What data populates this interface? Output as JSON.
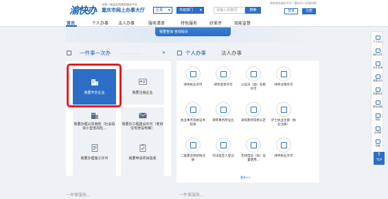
{
  "header": {
    "logo": "渝快办",
    "logo_sub": "全国一体化在线政务服务平台",
    "portal_title": "重庆市网上办事大厅",
    "region_select": "区县",
    "dept_select": "市级部门",
    "search_placeholder": "请输入关键词",
    "search_button": "搜索",
    "top_links": "渝快政务服务平台 | 重庆市人民政府网",
    "login": "登录",
    "register": "注册"
  },
  "nav": {
    "items": [
      "首页",
      "个人办事",
      "法人办事",
      "服务清单",
      "特色服务",
      "好差评",
      "效能监督"
    ]
  },
  "banner": {
    "text": "我要查询 咨询投诉"
  },
  "sections": {
    "one_thing": "一件事一次办",
    "one_thing_more": "»",
    "tab_personal": "个人办事",
    "tab_legal": "法人办事",
    "more": "更多>>"
  },
  "one_thing_tiles": [
    {
      "label": "我要开办企业"
    },
    {
      "label": "我要注销企业"
    },
    {
      "label": "我要办理公共用地（社会投资小型低风险..."
    },
    {
      "label": "我要办工程建设许可（老旧住宅增设电梯）"
    },
    {
      "label": "我要办理施工许可"
    },
    {
      "label": "我要申请项目验收"
    }
  ],
  "personal_services": [
    {
      "label": "律师执业许可"
    },
    {
      "label": "律师变更许可"
    },
    {
      "label": "公证员（副）任职许可"
    },
    {
      "label": "律师注销许可"
    },
    {
      "label": "执业事务资格证书核发"
    },
    {
      "label": "律师事务所设立"
    },
    {
      "label": "高校教师资格认定"
    },
    {
      "label": "护士执业注册（执业注册）"
    },
    {
      "label": "二级建造师初始注册"
    },
    {
      "label": "司法鉴定人登记"
    },
    {
      "label": "无线电台（站）设置使用..."
    },
    {
      "label": "律师执业许可"
    }
  ],
  "sidebar": {
    "items": [
      "个人中心",
      "我的办件",
      "办件查询",
      "我要评价",
      "我要投诉",
      "网站地图",
      "帮助",
      "无障碍",
      "收藏"
    ],
    "top_label": "TOP"
  },
  "bottom": {
    "left": "一件事服务...",
    "right": "一件事服务..."
  }
}
